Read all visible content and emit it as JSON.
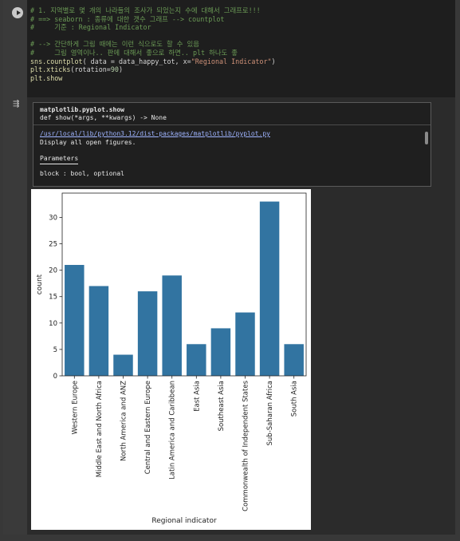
{
  "cell": {
    "code_lines": [
      [
        {
          "t": "# 1. 지역별로 몇 개의 나라들의 조사가 되었는지 수에 대해서 그래프로!!!",
          "c": "com"
        }
      ],
      [
        {
          "t": "# ==> seaborn : 종류에 대한 갯수 그래프 --> countplot",
          "c": "com"
        }
      ],
      [
        {
          "t": "#     기준 : Regional Indicator",
          "c": "com"
        }
      ],
      [
        {
          "t": "",
          "c": ""
        }
      ],
      [
        {
          "t": "# --> 간단하게 그림 때에는 이런 식으로도 할 수 있음",
          "c": "com"
        }
      ],
      [
        {
          "t": "#     그림 영역이나.. 판에 대해서 좋으로 하면.. plt 하나도 좋",
          "c": "com"
        }
      ],
      [
        {
          "t": "sns.countplot",
          "c": "kw"
        },
        {
          "t": "( data = data_happy_tot, x=",
          "c": ""
        },
        {
          "t": "\"Regional Indicator\"",
          "c": "str"
        },
        {
          "t": ")",
          "c": ""
        }
      ],
      [
        {
          "t": "plt.xticks",
          "c": "kw"
        },
        {
          "t": "(rotation=",
          "c": ""
        },
        {
          "t": "90",
          "c": "num"
        },
        {
          "t": ")",
          "c": ""
        }
      ],
      [
        {
          "t": "plt.show",
          "c": "kw"
        }
      ]
    ]
  },
  "tooltip": {
    "title": "matplotlib.pyplot.show",
    "signature": "def show(*args, **kwargs) -> None",
    "path": "/usr/local/lib/python3.12/dist-packages/matplotlib/pyplot.py",
    "description": "Display all open figures.",
    "params_header": "Parameters",
    "param_line": "block : bool, optional"
  },
  "chart_data": {
    "type": "bar",
    "categories": [
      "Western Europe",
      "Middle East and North Africa",
      "North America and ANZ",
      "Central and Eastern Europe",
      "Latin America and Caribbean",
      "East Asia",
      "Southeast Asia",
      "Commonwealth of Independent States",
      "Sub-Saharan Africa",
      "South Asia"
    ],
    "values": [
      21,
      17,
      4,
      16,
      19,
      6,
      9,
      12,
      33,
      6
    ],
    "xlabel": "Regional indicator",
    "ylabel": "count",
    "ylim": [
      0,
      34.6
    ],
    "yticks": [
      0,
      5,
      10,
      15,
      20,
      25,
      30
    ],
    "bar_color": "#3274a1",
    "grid": false
  }
}
